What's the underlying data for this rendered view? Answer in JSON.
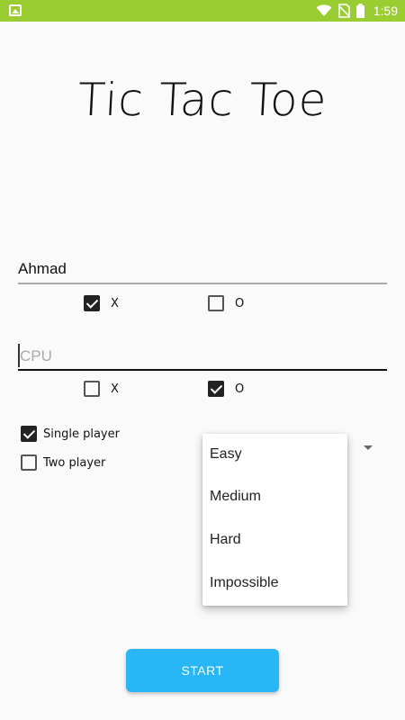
{
  "status_bar": {
    "time": "1:59",
    "icons": [
      "image-icon",
      "wifi-icon",
      "no-sim-icon",
      "battery-icon"
    ],
    "background": "#9acd32"
  },
  "title": "Tic Tac Toe",
  "player1": {
    "name_value": "Ahmad",
    "symbol_x_label": "X",
    "symbol_o_label": "O",
    "symbol_x_checked": true,
    "symbol_o_checked": false
  },
  "player2": {
    "name_placeholder": "CPU",
    "symbol_x_label": "X",
    "symbol_o_label": "O",
    "symbol_x_checked": false,
    "symbol_o_checked": true
  },
  "mode": {
    "single_label": "Single player",
    "two_label": "Two player",
    "single_checked": true,
    "two_checked": false
  },
  "difficulty_menu": {
    "items": [
      "Easy",
      "Medium",
      "Hard",
      "Impossible"
    ]
  },
  "start_button": "START",
  "colors": {
    "accent": "#29b6f6"
  }
}
